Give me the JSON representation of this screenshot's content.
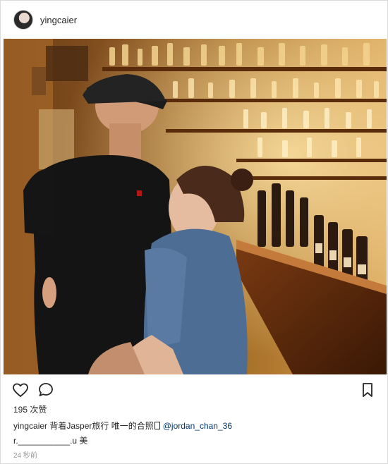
{
  "post": {
    "username": "yingcaier",
    "likes": "195 次赞",
    "caption_user": "yingcaier",
    "caption_text": "背着Jasper旅行 唯一的合照",
    "caption_glyph": " ",
    "caption_mention": "@jordan_chan_36",
    "comment": "r.___________.u 美",
    "time": "24 秒前"
  },
  "icons": {
    "like": "heart-icon",
    "comment": "comment-bubble-icon",
    "save": "bookmark-icon"
  },
  "colors": {
    "text": "#262626",
    "mention": "#003569",
    "muted": "#999999",
    "border": "#dbdbdb"
  }
}
